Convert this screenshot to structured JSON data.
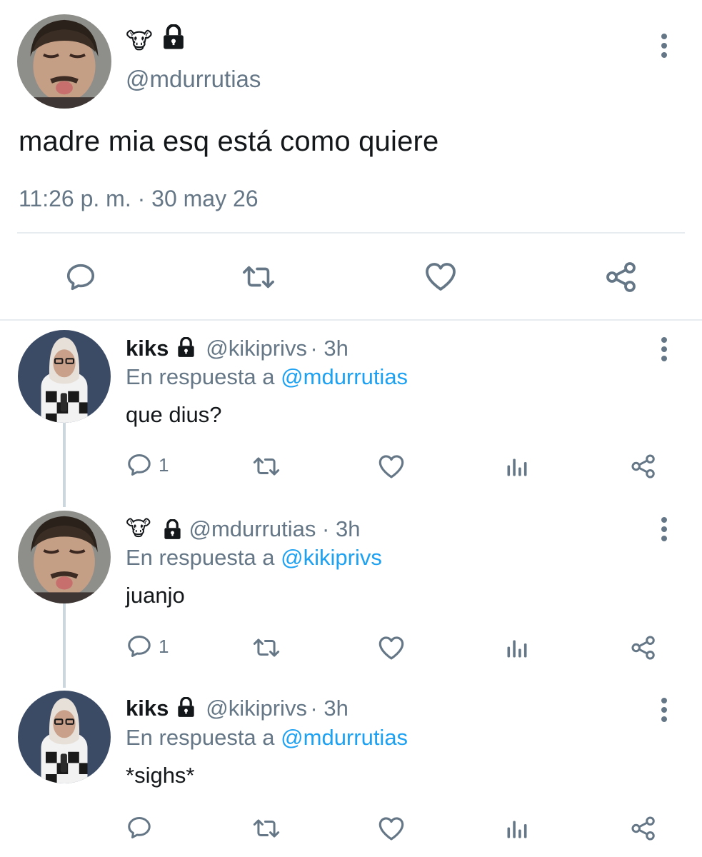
{
  "main_tweet": {
    "emoji": "🐮",
    "handle": "@mdurrutias",
    "text": "madre mia esq está como quiere",
    "meta": "11:26 p. m. · 30 may 26"
  },
  "replies": [
    {
      "name": "kiks",
      "handle": "@kikiprivs",
      "time": "3h",
      "reply_prefix": "En respuesta a",
      "reply_to": "@mdurrutias",
      "text": "que dius?",
      "reply_count": "1"
    },
    {
      "emoji": "🐮",
      "handle": "@mdurrutias",
      "time": "3h",
      "reply_prefix": "En respuesta a",
      "reply_to": "@kikiprivs",
      "text": "juanjo",
      "reply_count": "1"
    },
    {
      "name": "kiks",
      "handle": "@kikiprivs",
      "time": "3h",
      "reply_prefix": "En respuesta a",
      "reply_to": "@mdurrutias",
      "text": "*sighs*",
      "reply_count": ""
    }
  ],
  "icons": {
    "reply": "speech-bubble-icon",
    "retweet": "retweet-icon",
    "like": "heart-icon",
    "analytics": "bar-chart-icon",
    "share": "share-icon",
    "more": "vertical-dots-icon",
    "lock": "lock-icon"
  },
  "colors": {
    "text": "#14171a",
    "muted": "#657786",
    "link": "#1da1f2",
    "divider": "#e6ecf0",
    "thread_line": "#ccd6dd"
  }
}
